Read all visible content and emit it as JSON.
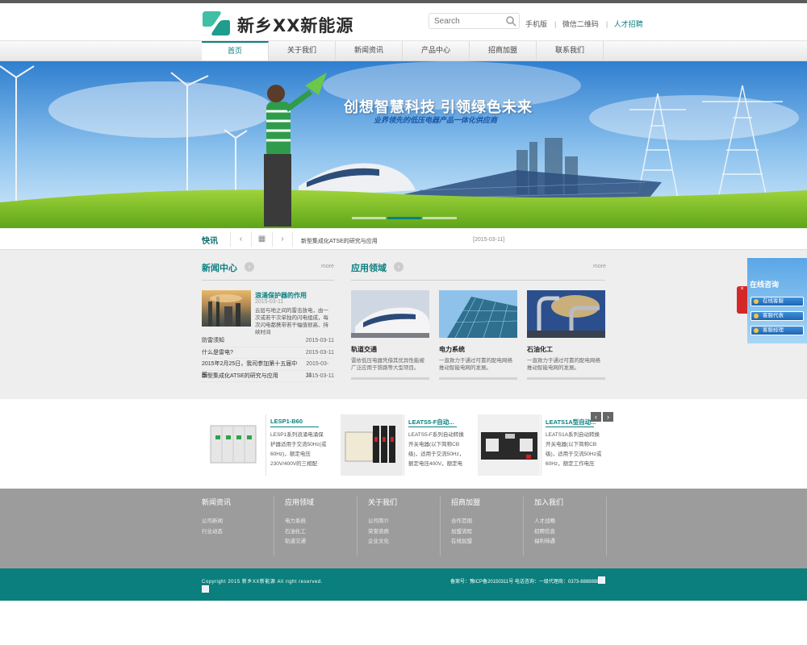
{
  "header": {
    "logo_text": "新乡XX新能源",
    "search_placeholder": "Search",
    "links": [
      "手机版",
      "微信二维码",
      "人才招聘"
    ]
  },
  "nav": {
    "items": [
      "首页",
      "关于我们",
      "新闻资讯",
      "产品中心",
      "招商加盟",
      "联系我们"
    ],
    "active": 0
  },
  "banner": {
    "title": "创想智慧科技 引领绿色未来",
    "subtitle": "业界领先的低压电器产品一体化供应商"
  },
  "ticker": {
    "label": "快讯",
    "prev": "‹",
    "list": "▦",
    "next": "›",
    "text": "新型集成化ATSE的研究与应用",
    "date": "[2015-03-11]"
  },
  "news": {
    "title": "新闻中心",
    "arrow": "›",
    "more": "more",
    "featured": {
      "title": "浪涌保护器的作用",
      "date": "2015-03-11",
      "desc": "云层与地之间的雷击放电，由一次或若干次单独的闪电组成，每次闪电都携带若干幅值很高、持续时间"
    },
    "items": [
      {
        "title": "防雷须知",
        "date": "2015-03-11"
      },
      {
        "title": "什么是雷电?",
        "date": "2015-03-11"
      },
      {
        "title": "2015年2月25日，我司参加第十五届中国...",
        "date": "2015-03-11"
      },
      {
        "title": "新型集成化ATSE的研究与应用",
        "date": "2015-03-11"
      }
    ]
  },
  "apps": {
    "title": "应用领域",
    "arrow": "›",
    "more": "more",
    "items": [
      {
        "name": "轨道交通",
        "desc": "雷依低压电器凭借其优异性能被广泛应用于铁路等大型项目。"
      },
      {
        "name": "电力系统",
        "desc": "一直致力于通过可靠的配电网络推动智能电网的发展。"
      },
      {
        "name": "石油化工",
        "desc": "一直致力于通过可靠的配电网络推动智能电网的发展。"
      }
    ]
  },
  "products": {
    "prev": "‹",
    "next": "›",
    "items": [
      {
        "name": "LESP1-B60",
        "desc": "LESP1系列浪涌电涌保护器适用于交流50Hz(或60Hz)，额定电压230V/400V的三相配"
      },
      {
        "name": "LEATS5-F自动...",
        "desc": "LEATS5-F系列自动转换开关电器(以下简称CB级)，适用于交流50Hz，额定电压400V，额定电"
      },
      {
        "name": "LEATS1A型自动...",
        "desc": "LEATS1A系列自动转换开关电器(以下简称CB级)，适用于交流50Hz或60Hz，额定工作电压"
      }
    ]
  },
  "footer": {
    "columns": [
      {
        "title": "新闻资讯",
        "links": [
          "公司新闻",
          "行业动态"
        ]
      },
      {
        "title": "应用领域",
        "links": [
          "电力系统",
          "石油化工",
          "轨道交通"
        ]
      },
      {
        "title": "关于我们",
        "links": [
          "公司简介",
          "荣誉资质",
          "企业文化"
        ]
      },
      {
        "title": "招商加盟",
        "links": [
          "合作范围",
          "加盟流程",
          "在线加盟"
        ]
      },
      {
        "title": "加入我们",
        "links": [
          "人才战略",
          "招聘信息",
          "福利待遇"
        ]
      }
    ],
    "copyright": "Copyright 2015 新乡XX新能源 All right reserved.",
    "icp": "备案号：豫ICP备20150311号   电话咨询：一级代理商：0373-88888888"
  },
  "side": {
    "title": "在线咨询",
    "buttons": [
      "在线客服",
      "客服代表",
      "客服经理"
    ],
    "tab": "×"
  },
  "colors": {
    "accent": "#0b8082",
    "footer_gray": "#9c9c9c",
    "copyright_teal": "#0a7f7d"
  }
}
